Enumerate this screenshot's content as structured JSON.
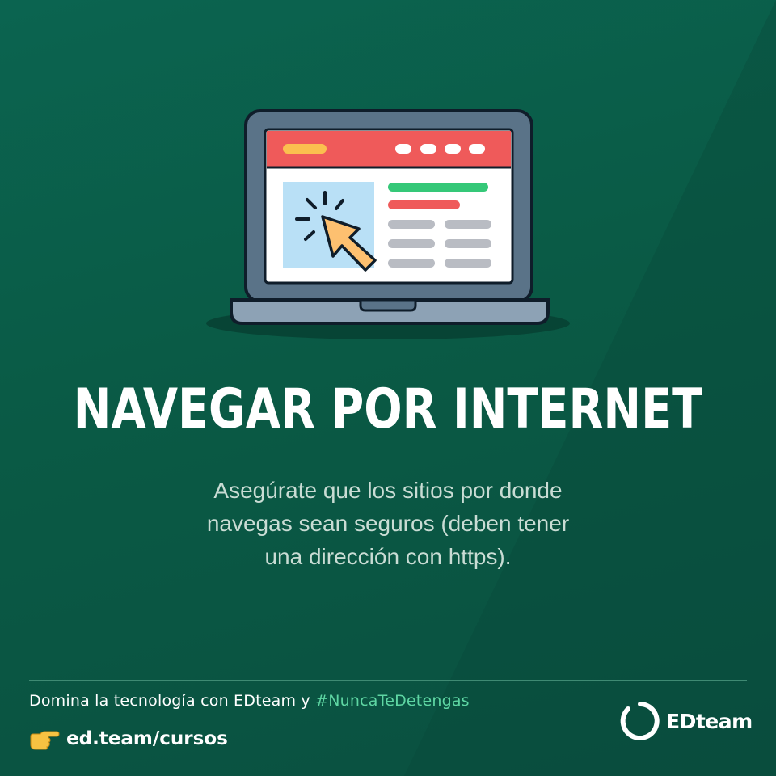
{
  "headline": "NAVEGAR POR INTERNET",
  "subtitle": {
    "lines": [
      "Asegúrate que los sitios por donde",
      "navegas sean seguros (deben tener",
      "una dirección con https)."
    ]
  },
  "footer": {
    "tagline_prefix": "Domina la tecnología con EDteam y ",
    "hashtag": "#NuncaTeDetengas",
    "link": "ed.team/cursos",
    "brand": "EDteam"
  },
  "colors": {
    "background": "#0a5e48",
    "browser_bar": "#ef5a5a",
    "hashtag": "#5ed6a3",
    "cursor": "#fdc070"
  },
  "icons": {
    "illustration": "laptop-browser-icon",
    "cursor": "cursor-click-icon",
    "hand": "pointing-hand-icon",
    "logo": "edteam-logo"
  }
}
